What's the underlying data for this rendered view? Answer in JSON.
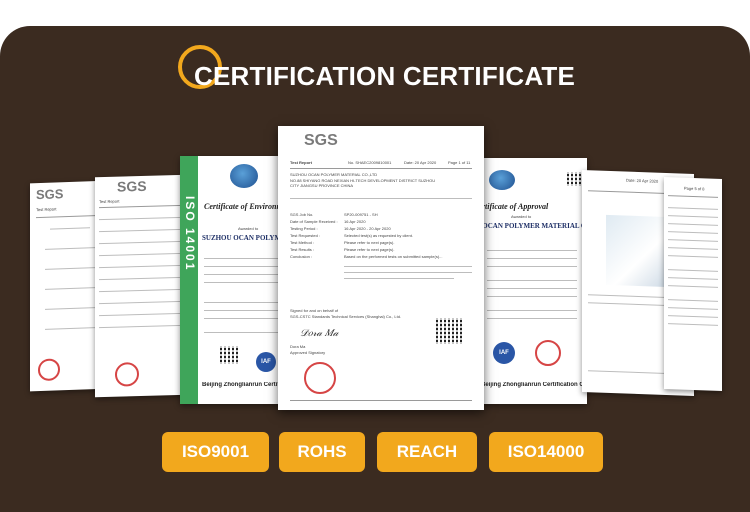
{
  "title": "CERTIFICATION CERTIFICATE",
  "badges": [
    "ISO9001",
    "ROHS",
    "REACH",
    "ISO14000"
  ],
  "colors": {
    "background": "#3b2b20",
    "accent": "#f2a81d",
    "badge_text": "#ffffff"
  },
  "documents": {
    "far_left": {
      "logo": "SGS",
      "header": "Test Report"
    },
    "left": {
      "logo": "SGS",
      "header": "Test Report"
    },
    "iso14001": {
      "band": "ISO 14001",
      "title": "Certificate of Environment Management",
      "awarded": "Awarded to",
      "company": "SUZHOU OCAN POLYMER MATERIAL CO., LTD.",
      "issuer": "Beijing Zhonglianrun Certification Center"
    },
    "center": {
      "logo": "SGS",
      "header": "Test Report",
      "report_no": "No. SHAEC2009810001",
      "date": "Date: 20 Apr 2020",
      "page": "Page 1 of 11",
      "company": "SUZHOU OCAN POLYMER MATERIAL CO.,LTD",
      "address": "NO.88 SHIYANG ROAD NEXIAN HI-TECH DEVELOPMENT DISTRICT SUZHOU CITY JIANGSU PROVINCE CHINA",
      "fields": [
        {
          "label": "SGS Job No.",
          "value": "SP20-009751 - SH"
        },
        {
          "label": "Date of Sample Received :",
          "value": "16 Apr 2020"
        },
        {
          "label": "Testing Period :",
          "value": "16 Apr 2020 - 20 Apr 2020"
        },
        {
          "label": "Test Requested :",
          "value": "Selected test(s) as requested by client."
        },
        {
          "label": "Test Method :",
          "value": "Please refer to next page(s)."
        },
        {
          "label": "Test Results :",
          "value": "Please refer to next page(s)."
        },
        {
          "label": "Conclusion :",
          "value": "Based on the performed tests on submitted sample(s)..."
        }
      ],
      "signed": "Signed for and on behalf of",
      "signer_org": "SGS-CSTC Standards Technical Services (Shanghai) Co., Ltd.",
      "signer": "Dora Ma",
      "signer_title": "Approved Signatory"
    },
    "iso9001": {
      "title": "Certificate of Approval",
      "awarded": "Awarded to",
      "company": "SUZHOU OCAN POLYMER MATERIAL CO., LTD.",
      "issuer": "Beijing Zhonglianrun Certification Center"
    },
    "right": {
      "date": "Date: 20 Apr 2020",
      "page": "Page 8 of 8"
    },
    "far_right": {
      "page": "Page 5 of 8"
    }
  }
}
